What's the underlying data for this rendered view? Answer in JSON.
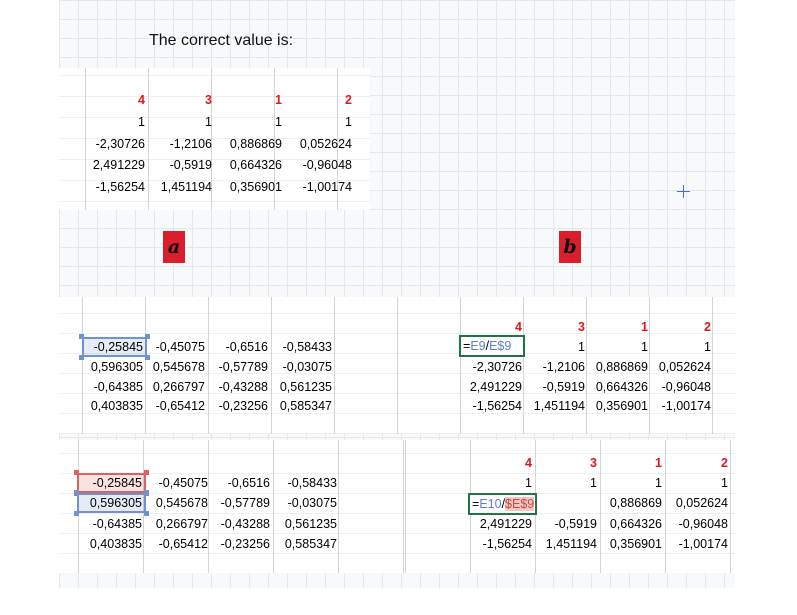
{
  "intro_text": "The correct value is:",
  "labels": {
    "a": "a",
    "b": "b"
  },
  "colors": {
    "header_red": "#e0181e",
    "tag_red": "#d81f2b",
    "ref_blue": "#5b7fc7",
    "ref_red": "#c84b43",
    "edit_green": "#217346"
  },
  "correct_table": {
    "headers": [
      "4",
      "3",
      "1",
      "2"
    ],
    "rows": [
      [
        "1",
        "1",
        "1",
        "1"
      ],
      [
        "-2,30726",
        "-1,2106",
        "0,886869",
        "0,052624"
      ],
      [
        "2,491229",
        "-0,5919",
        "0,664326",
        "-0,96048"
      ],
      [
        "-1,56254",
        "1,451194",
        "0,356901",
        "-1,00174"
      ]
    ]
  },
  "panel_b1": {
    "left_rows": [
      [
        "-0,25845",
        "-0,45075",
        "-0,6516",
        "-0,58433"
      ],
      [
        "0,596305",
        "0,545678",
        "-0,57789",
        "-0,03075"
      ],
      [
        "-0,64385",
        "0,266797",
        "-0,43288",
        "0,561235"
      ],
      [
        "0,403835",
        "-0,65412",
        "-0,23256",
        "0,585347"
      ]
    ],
    "right_headers": [
      "4",
      "3",
      "1",
      "2"
    ],
    "right_rows": [
      [
        "",
        "1",
        "1",
        "1"
      ],
      [
        "-2,30726",
        "-1,2106",
        "0,886869",
        "0,052624"
      ],
      [
        "2,491229",
        "-0,5919",
        "0,664326",
        "-0,96048"
      ],
      [
        "-1,56254",
        "1,451194",
        "0,356901",
        "-1,00174"
      ]
    ],
    "formula": {
      "eq": "=",
      "a": "E9",
      "slash": "/",
      "b": "E$9"
    }
  },
  "panel_b2": {
    "left_rows": [
      [
        "-0,25845",
        "-0,45075",
        "-0,6516",
        "-0,58433"
      ],
      [
        "0,596305",
        "0,545678",
        "-0,57789",
        "-0,03075"
      ],
      [
        "-0,64385",
        "0,266797",
        "-0,43288",
        "0,561235"
      ],
      [
        "0,403835",
        "-0,65412",
        "-0,23256",
        "0,585347"
      ]
    ],
    "right_headers": [
      "4",
      "3",
      "1",
      "2"
    ],
    "right_rows": [
      [
        "1",
        "1",
        "1",
        "1"
      ],
      [
        "",
        "",
        "0,886869",
        "0,052624"
      ],
      [
        "2,491229",
        "-0,5919",
        "0,664326",
        "-0,96048"
      ],
      [
        "-1,56254",
        "1,451194",
        "0,356901",
        "-1,00174"
      ]
    ],
    "formula": {
      "eq": "=",
      "a": "E10",
      "slash": "/",
      "b": "$E$9"
    }
  }
}
